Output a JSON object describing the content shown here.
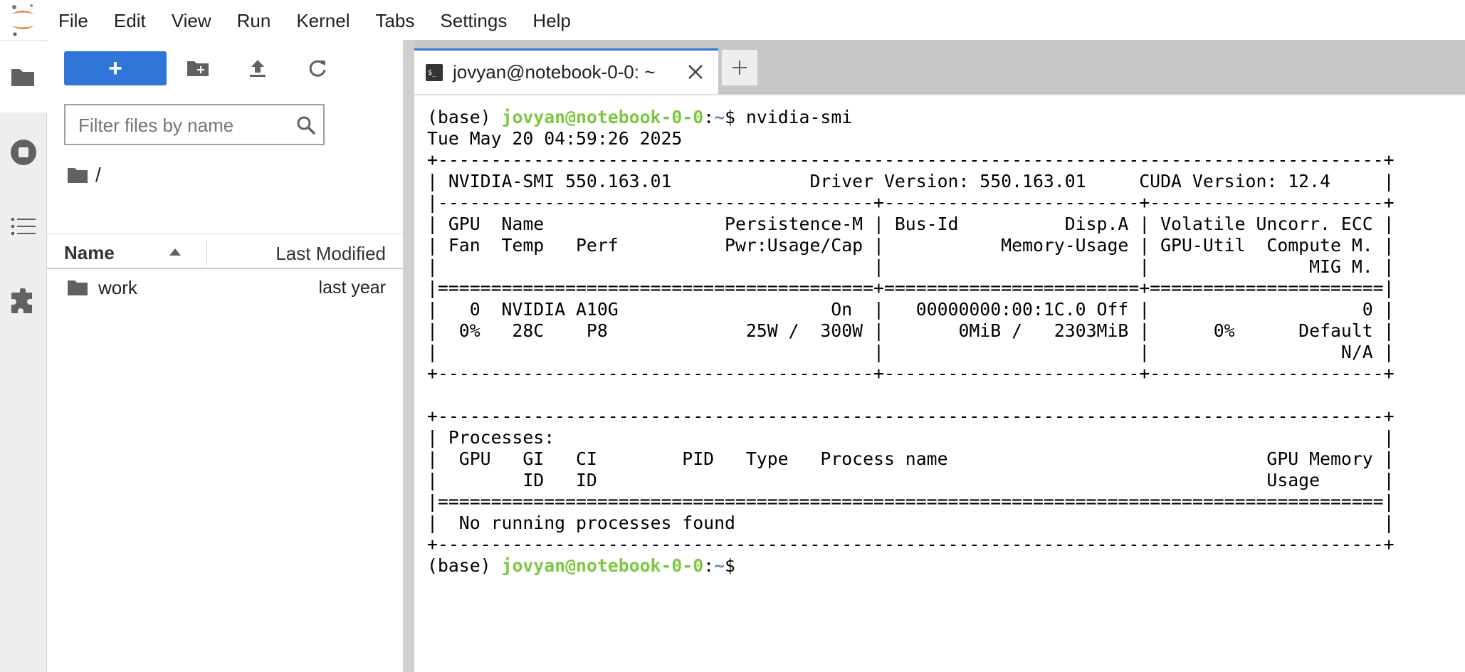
{
  "menubar": {
    "items": [
      "File",
      "Edit",
      "View",
      "Run",
      "Kernel",
      "Tabs",
      "Settings",
      "Help"
    ]
  },
  "filebrowser": {
    "new_button_label": "+",
    "filter_placeholder": "Filter files by name",
    "breadcrumb": "/",
    "columns": {
      "name": "Name",
      "modified": "Last Modified"
    },
    "rows": [
      {
        "name": "work",
        "modified": "last year",
        "type": "folder"
      }
    ]
  },
  "tabs": [
    {
      "label": "jovyan@notebook-0-0: ~",
      "icon": "terminal-icon",
      "active": true
    }
  ],
  "terminal": {
    "prompt_env": "(base) ",
    "prompt_user": "jovyan@notebook-0-0",
    "prompt_sep": ":",
    "prompt_path": "~",
    "prompt_end": "$ ",
    "command": "nvidia-smi",
    "output": "Tue May 20 04:59:26 2025\n+-----------------------------------------------------------------------------------------+\n| NVIDIA-SMI 550.163.01             Driver Version: 550.163.01     CUDA Version: 12.4     |\n|-----------------------------------------+------------------------+----------------------+\n| GPU  Name                 Persistence-M | Bus-Id          Disp.A | Volatile Uncorr. ECC |\n| Fan  Temp   Perf          Pwr:Usage/Cap |           Memory-Usage | GPU-Util  Compute M. |\n|                                         |                        |               MIG M. |\n|=========================================+========================+======================|\n|   0  NVIDIA A10G                    On  |   00000000:00:1C.0 Off |                    0 |\n|  0%   28C    P8             25W /  300W |       0MiB /   2303MiB |      0%      Default |\n|                                         |                        |                  N/A |\n+-----------------------------------------+------------------------+----------------------+\n\n+-----------------------------------------------------------------------------------------+\n| Processes:                                                                              |\n|  GPU   GI   CI        PID   Type   Process name                              GPU Memory |\n|        ID   ID                                                               Usage      |\n|=========================================================================================|\n|  No running processes found                                                             |\n+-----------------------------------------------------------------------------------------+"
  },
  "colors": {
    "accent": "#2f76d8",
    "prompt_user": "#7cc843",
    "prompt_path": "#5c8fce",
    "jupyter_orange": "#f37726"
  }
}
